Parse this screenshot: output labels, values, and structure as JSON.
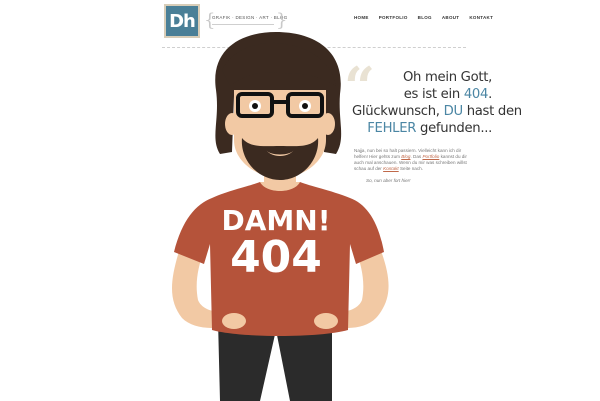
{
  "header": {
    "logo_text": "Dh",
    "tagline": "Grafik · Design · Art · Blog",
    "nav": [
      "Home",
      "Portfolio",
      "Blog",
      "About",
      "Kontakt"
    ]
  },
  "error": {
    "headline_lines": [
      [
        "Oh mein Gott,"
      ],
      [
        "es ist ein ",
        "404",
        "."
      ],
      [
        "Glückwunsch, ",
        "DU",
        " hast den"
      ],
      [
        "FEHLER",
        " gefunden..."
      ]
    ],
    "body": [
      "Najja, nun bei so halt passiern. Vielleicht kann ich dir helfen! Hier gehts zum ",
      "Blog",
      ". Das ",
      "Portfolio",
      " kannst du dir auch mal anschauen. Wenn du mir was schreiben willst schau auf der ",
      "Kontakt",
      " Seite nach."
    ],
    "signature": "So, nun aber fort hier!"
  },
  "shirt": {
    "line1": "DAMN!",
    "line2": "404"
  },
  "colors": {
    "logo_bg": "#4a7f97",
    "accent_blue": "#4b86a4",
    "shirt": "#b5533a",
    "hair": "#3b2a20",
    "skin": "#f2c9a4"
  }
}
